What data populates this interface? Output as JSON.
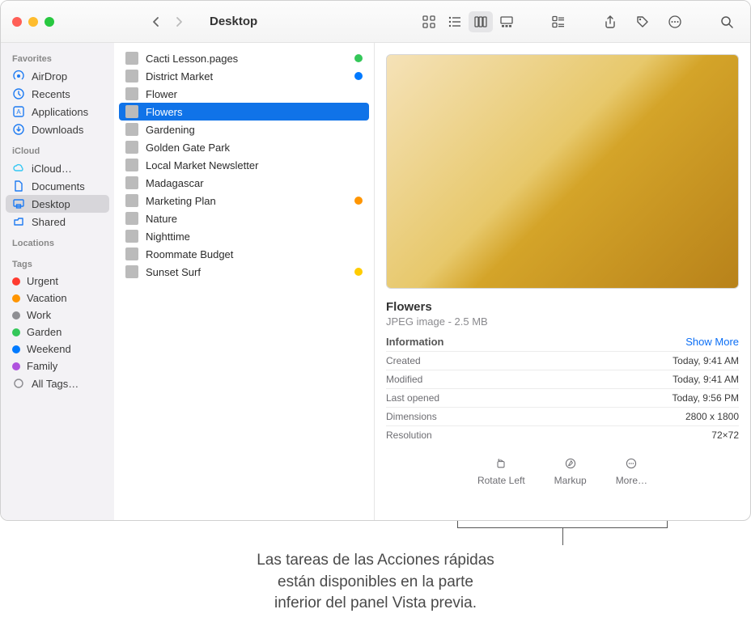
{
  "window": {
    "title": "Desktop"
  },
  "sidebar": {
    "sections": [
      {
        "heading": "Favorites",
        "items": [
          {
            "label": "AirDrop",
            "icon": "airdrop"
          },
          {
            "label": "Recents",
            "icon": "clock"
          },
          {
            "label": "Applications",
            "icon": "apps"
          },
          {
            "label": "Downloads",
            "icon": "downloads"
          }
        ]
      },
      {
        "heading": "iCloud",
        "items": [
          {
            "label": "iCloud…",
            "icon": "cloud"
          },
          {
            "label": "Documents",
            "icon": "doc"
          },
          {
            "label": "Desktop",
            "icon": "desktop",
            "selected": true
          },
          {
            "label": "Shared",
            "icon": "shared"
          }
        ]
      },
      {
        "heading": "Locations",
        "items": []
      },
      {
        "heading": "Tags",
        "items": [
          {
            "label": "Urgent",
            "color": "#ff3b30"
          },
          {
            "label": "Vacation",
            "color": "#ff9500"
          },
          {
            "label": "Work",
            "color": "#8e8e93"
          },
          {
            "label": "Garden",
            "color": "#34c759"
          },
          {
            "label": "Weekend",
            "color": "#007aff"
          },
          {
            "label": "Family",
            "color": "#af52de"
          },
          {
            "label": "All Tags…",
            "color": null
          }
        ]
      }
    ]
  },
  "files": [
    {
      "name": "Cacti Lesson.pages",
      "tag": "#34c759"
    },
    {
      "name": "District Market",
      "tag": "#007aff"
    },
    {
      "name": "Flower"
    },
    {
      "name": "Flowers",
      "selected": true
    },
    {
      "name": "Gardening"
    },
    {
      "name": "Golden Gate Park"
    },
    {
      "name": "Local Market Newsletter"
    },
    {
      "name": "Madagascar"
    },
    {
      "name": "Marketing Plan",
      "tag": "#ff9500"
    },
    {
      "name": "Nature"
    },
    {
      "name": "Nighttime"
    },
    {
      "name": "Roommate Budget"
    },
    {
      "name": "Sunset Surf",
      "tag": "#ffcc00"
    }
  ],
  "preview": {
    "title": "Flowers",
    "subtitle": "JPEG image - 2.5 MB",
    "info_label": "Information",
    "show_more": "Show More",
    "rows": [
      {
        "k": "Created",
        "v": "Today, 9:41 AM"
      },
      {
        "k": "Modified",
        "v": "Today, 9:41 AM"
      },
      {
        "k": "Last opened",
        "v": "Today, 9:56 PM"
      },
      {
        "k": "Dimensions",
        "v": "2800 x 1800"
      },
      {
        "k": "Resolution",
        "v": "72×72"
      }
    ],
    "actions": [
      {
        "label": "Rotate Left",
        "icon": "rotate"
      },
      {
        "label": "Markup",
        "icon": "markup"
      },
      {
        "label": "More…",
        "icon": "more"
      }
    ]
  },
  "caption": {
    "line1": "Las tareas de las Acciones rápidas",
    "line2": "están disponibles en la parte",
    "line3": "inferior del panel Vista previa."
  }
}
